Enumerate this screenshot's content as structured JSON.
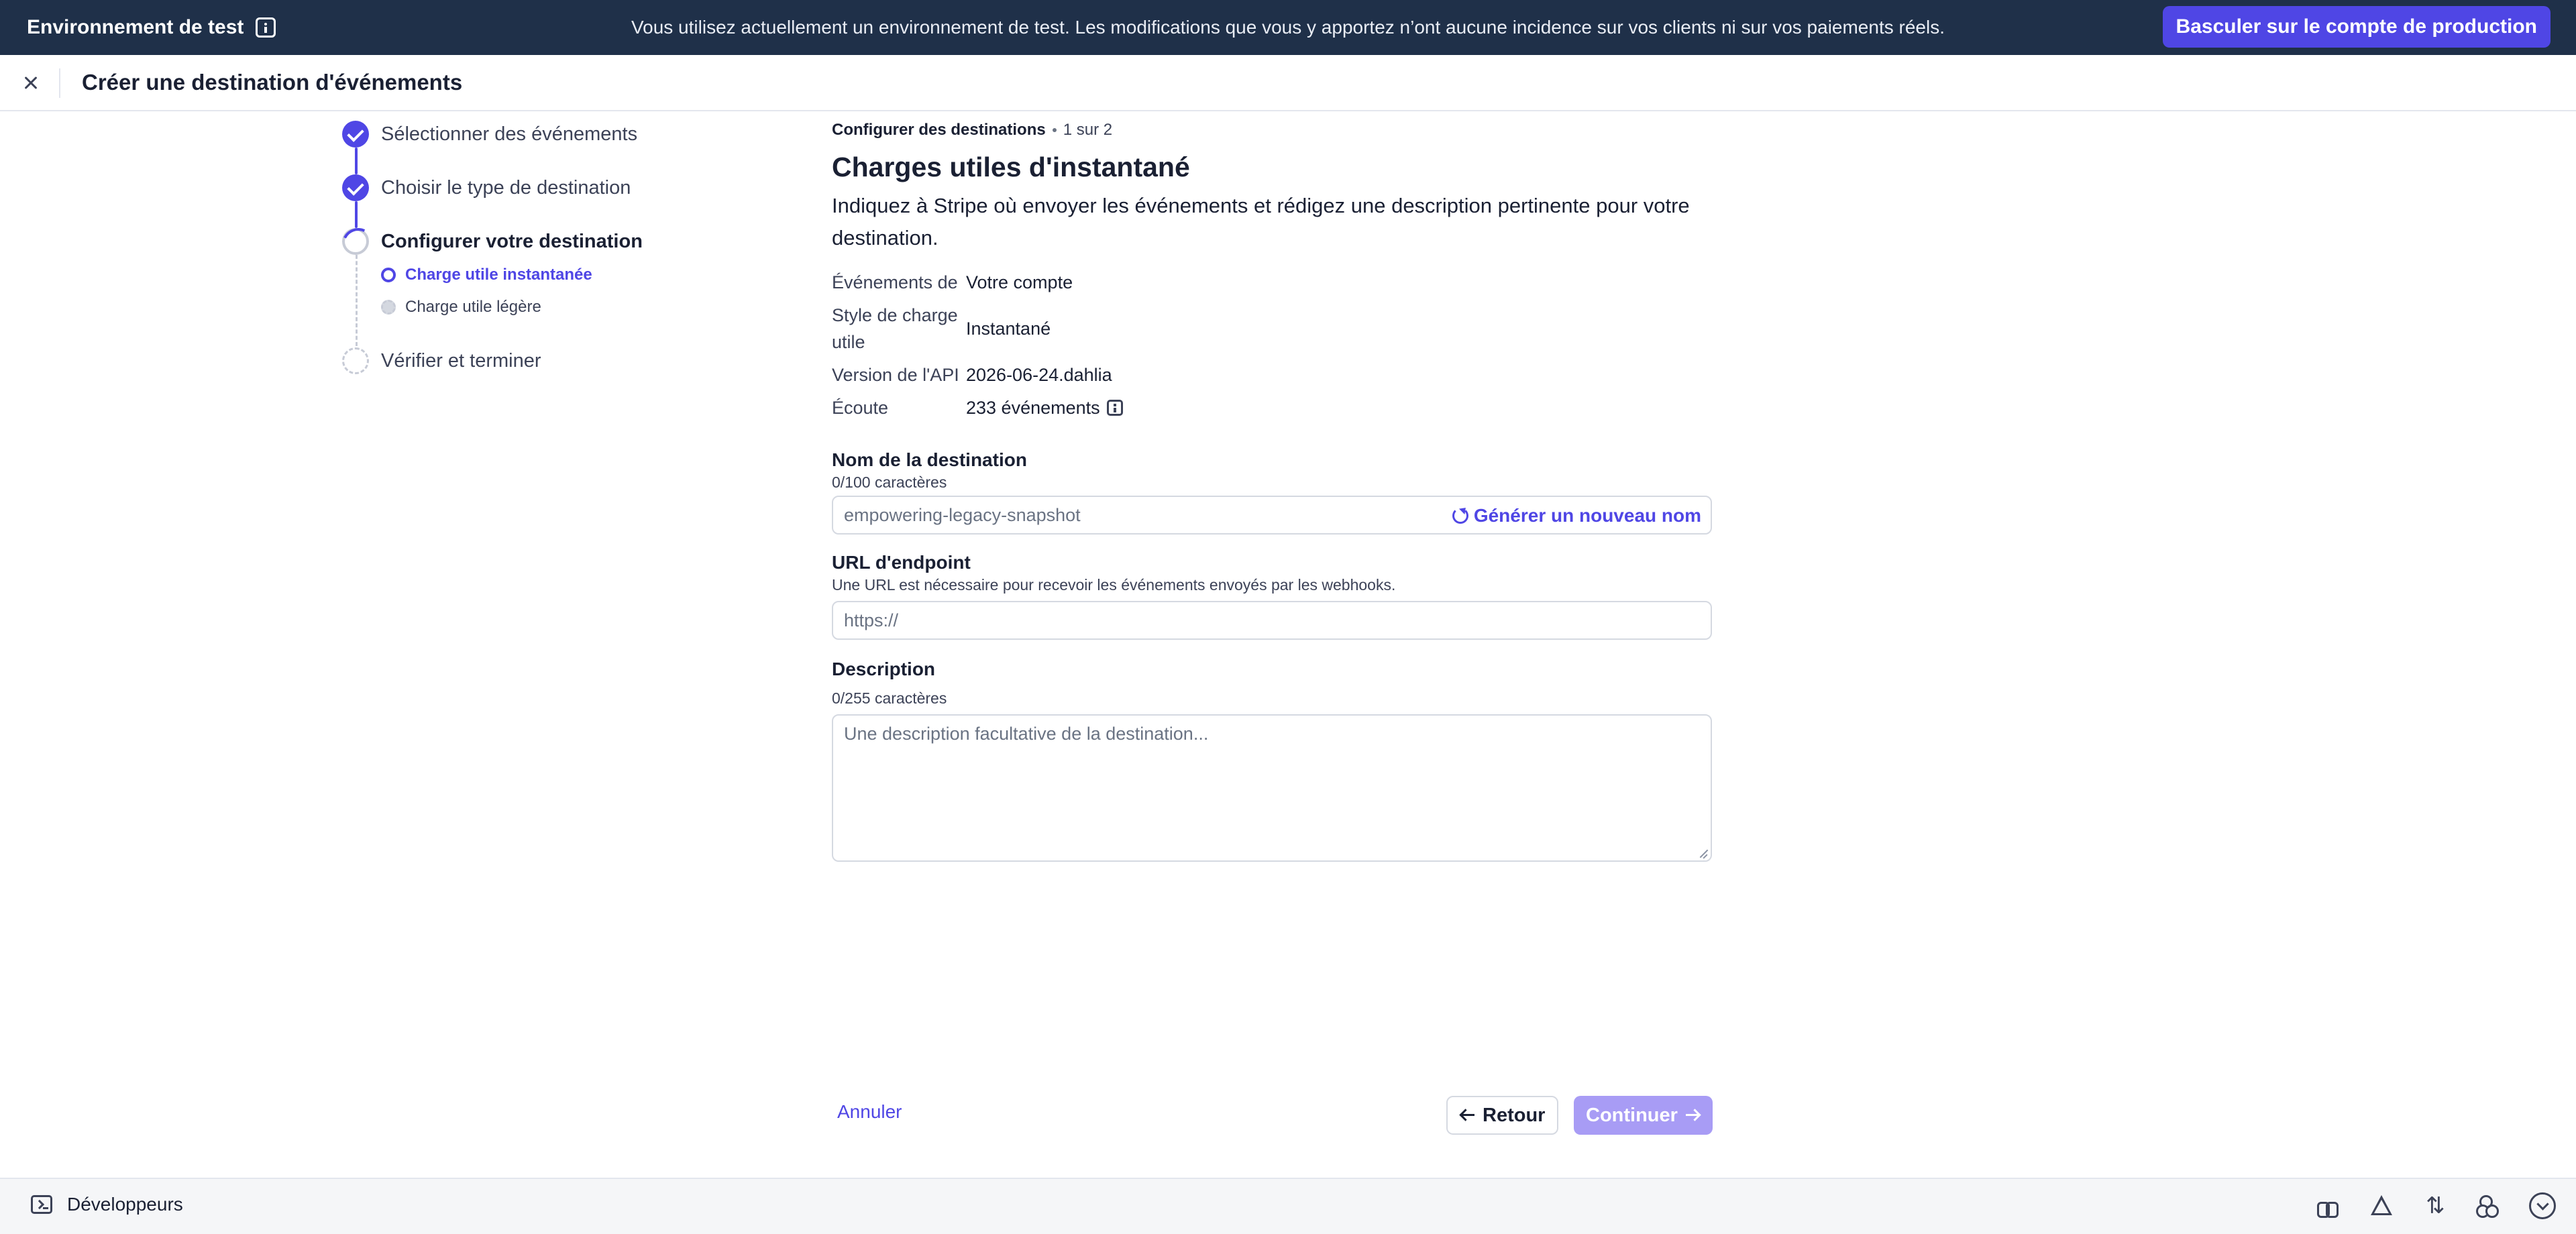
{
  "banner": {
    "env_label": "Environnement de test",
    "message": "Vous utilisez actuellement un environnement de test. Les modifications que vous y apportez n’ont aucune incidence sur vos clients ni sur vos paiements réels.",
    "switch_button": "Basculer sur le compte de production"
  },
  "sheet": {
    "title": "Créer une destination d'événements"
  },
  "stepper": {
    "steps": [
      {
        "label": "Sélectionner des événements",
        "state": "done"
      },
      {
        "label": "Choisir le type de destination",
        "state": "done"
      },
      {
        "label": "Configurer votre destination",
        "state": "current"
      },
      {
        "label": "Vérifier et terminer",
        "state": "todo"
      }
    ],
    "substeps": [
      {
        "label": "Charge utile instantanée",
        "state": "active"
      },
      {
        "label": "Charge utile légère",
        "state": "todo"
      }
    ]
  },
  "main": {
    "crumb_section": "Configurer des destinations",
    "crumb_progress": "1 sur 2",
    "title": "Charges utiles d'instantané",
    "lead": "Indiquez à Stripe où envoyer les événements et rédigez une description pertinente pour votre destination.",
    "properties": [
      {
        "key": "Événements de",
        "value": "Votre compte"
      },
      {
        "key": "Style de charge utile",
        "value": "Instantané"
      },
      {
        "key": "Version de l'API",
        "value": "2026-06-24.dahlia"
      },
      {
        "key": "Écoute",
        "value": "233 événements"
      }
    ],
    "name_field": {
      "label": "Nom de la destination",
      "counter": "0/100 caractères",
      "placeholder": "empowering-legacy-snapshot",
      "generate_label": "Générer un nouveau nom"
    },
    "url_field": {
      "label": "URL d'endpoint",
      "help": "Une URL est nécessaire pour recevoir les événements envoyés par les webhooks.",
      "placeholder": "https://"
    },
    "description_field": {
      "label": "Description",
      "counter": "0/255 caractères",
      "placeholder": "Une description facultative de la destination..."
    }
  },
  "actions": {
    "cancel": "Annuler",
    "back": "Retour",
    "continue": "Continuer",
    "continue_disabled": true
  },
  "devbar": {
    "label": "Développeurs",
    "icons": [
      "binoculars-icon",
      "warning-icon",
      "sort-arrows-icon",
      "webhook-icon",
      "chevron-down-circle-icon"
    ]
  },
  "colors": {
    "banner_bg": "#1f3049",
    "accent": "#4f46e5",
    "accent_disabled": "#a89cf5"
  }
}
